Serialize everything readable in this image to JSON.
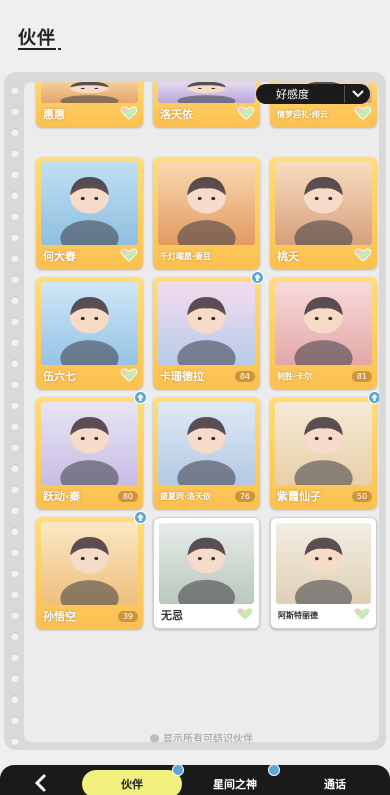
{
  "header": {
    "title": "伙伴"
  },
  "sort": {
    "label": "好感度"
  },
  "colors": {
    "card_gold": "#fbc050",
    "card_white": "#ffffff",
    "badge_blue": "#5aa6d6",
    "active_tab": "#f1ef7e"
  },
  "partners": [
    {
      "name": "惠惠",
      "level": "",
      "heart": true,
      "frame": "gold",
      "badge": false
    },
    {
      "name": "洛天依",
      "level": "",
      "heart": true,
      "frame": "gold",
      "badge": false
    },
    {
      "name": "情梦迎礼·绯云",
      "level": "",
      "heart": true,
      "frame": "gold",
      "badge": false
    },
    {
      "name": "何大春",
      "level": "",
      "heart": true,
      "frame": "gold",
      "badge": false
    },
    {
      "name": "千灯曜愿·妻豆",
      "level": "",
      "heart": false,
      "frame": "gold",
      "badge": false
    },
    {
      "name": "桃夭",
      "level": "",
      "heart": true,
      "frame": "gold",
      "badge": false
    },
    {
      "name": "伍六七",
      "level": "",
      "heart": true,
      "frame": "gold",
      "badge": false
    },
    {
      "name": "卡珊德拉",
      "level": "84",
      "heart": false,
      "frame": "gold",
      "badge": true
    },
    {
      "name": "制胜·卡尔",
      "level": "81",
      "heart": false,
      "frame": "gold",
      "badge": false
    },
    {
      "name": "跃动·秦",
      "level": "80",
      "heart": false,
      "frame": "gold",
      "badge": true
    },
    {
      "name": "盛夏同·洛天依",
      "level": "76",
      "heart": false,
      "frame": "gold",
      "badge": false
    },
    {
      "name": "紫霞仙子",
      "level": "50",
      "heart": false,
      "frame": "gold",
      "badge": true
    },
    {
      "name": "孙悟空",
      "level": "39",
      "heart": false,
      "frame": "gold",
      "badge": true
    },
    {
      "name": "无忌",
      "level": "",
      "heart": true,
      "frame": "white",
      "badge": false
    },
    {
      "name": "阿斯特丽德",
      "level": "",
      "heart": true,
      "frame": "white",
      "badge": false
    }
  ],
  "footer": {
    "note": "显示所有可结识伙伴"
  },
  "nav": {
    "tabs": [
      "伙伴",
      "星间之神",
      "通话"
    ],
    "active": "伙伴"
  }
}
